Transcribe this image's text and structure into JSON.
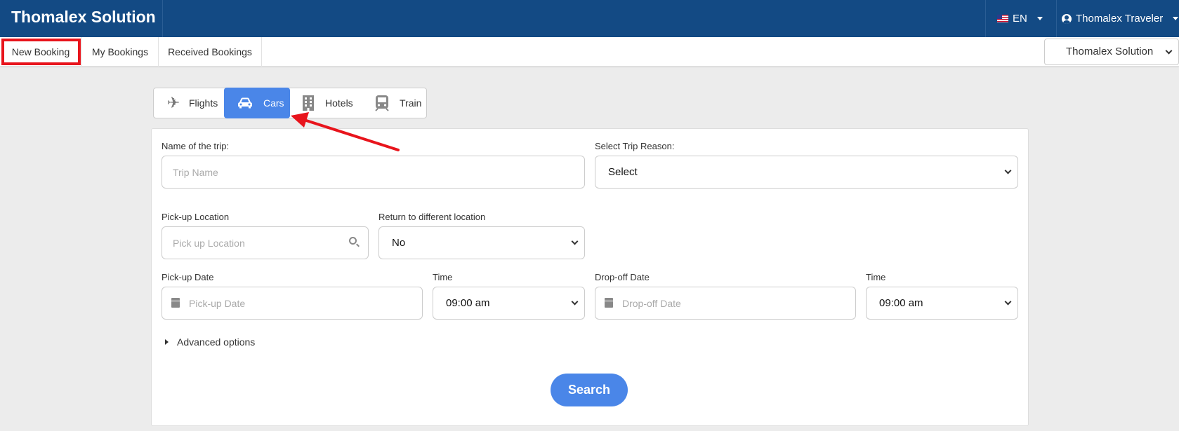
{
  "header": {
    "brand": "Thomalex Solution",
    "language": "EN",
    "user": "Thomalex Traveler"
  },
  "nav": {
    "items": [
      {
        "label": "New Booking"
      },
      {
        "label": "My Bookings"
      },
      {
        "label": "Received Bookings"
      }
    ],
    "company_select": "Thomalex Solution"
  },
  "mode_tabs": [
    {
      "label": "Flights",
      "icon": "plane-icon"
    },
    {
      "label": "Cars",
      "icon": "car-icon"
    },
    {
      "label": "Hotels",
      "icon": "building-icon"
    },
    {
      "label": "Train",
      "icon": "train-icon"
    }
  ],
  "form": {
    "trip_name_label": "Name of the trip:",
    "trip_name_placeholder": "Trip Name",
    "trip_reason_label": "Select Trip Reason:",
    "trip_reason_value": "Select",
    "pickup_location_label": "Pick-up Location",
    "pickup_location_placeholder": "Pick up Location",
    "return_label": "Return to different location",
    "return_value": "No",
    "pickup_date_label": "Pick-up Date",
    "pickup_date_placeholder": "Pick-up Date",
    "pickup_time_label": "Time",
    "pickup_time_value": "09:00 am",
    "dropoff_date_label": "Drop-off Date",
    "dropoff_date_placeholder": "Drop-off Date",
    "dropoff_time_label": "Time",
    "dropoff_time_value": "09:00 am",
    "advanced_options": "Advanced options",
    "search_button": "Search"
  },
  "colors": {
    "header_bg": "#134a84",
    "accent": "#4a86e8",
    "highlight": "#e8141c"
  }
}
